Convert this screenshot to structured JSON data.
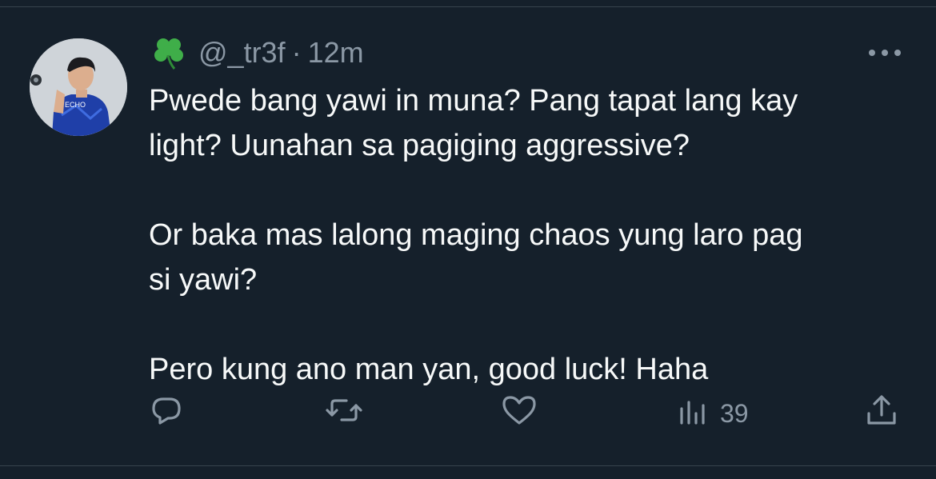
{
  "tweet": {
    "author": {
      "emoji": "🍀",
      "handle": "@_tr3f",
      "separator": "·",
      "timestamp": "12m"
    },
    "more_label": "•••",
    "text": "Pwede bang yawi in muna? Pang tapat lang kay\nlight? Uunahan sa pagiging aggressive?\n\nOr baka mas lalong maging chaos yung laro pag\nsi yawi?\n\nPero kung ano man yan, good luck! Haha",
    "stats": {
      "views_count": "39"
    },
    "avatar": {
      "jersey_text": "ECHO"
    }
  },
  "icons": {
    "reply": "reply-icon",
    "retweet": "retweet-icon",
    "like": "heart-icon",
    "views": "views-icon",
    "share": "share-icon",
    "more": "more-icon"
  },
  "colors": {
    "background": "#15202b",
    "text": "#f7f9f9",
    "muted": "#8b98a5",
    "divider": "#38444d"
  }
}
